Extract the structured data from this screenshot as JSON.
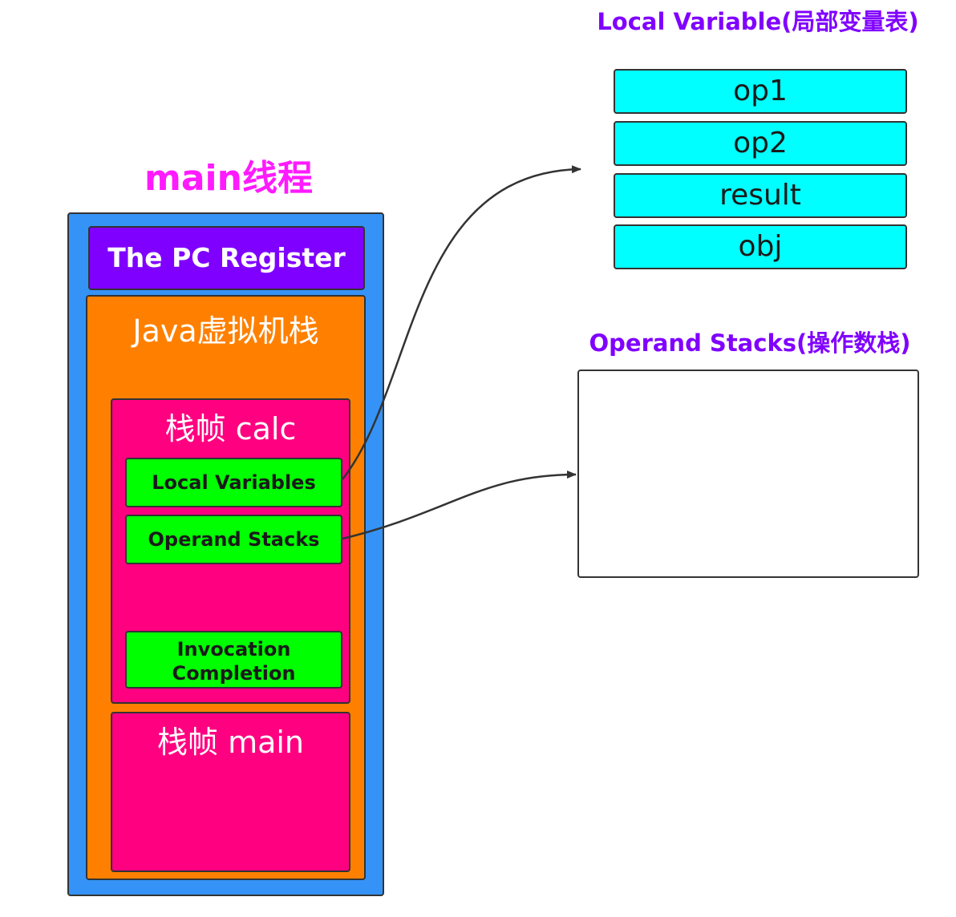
{
  "thread_title": "main线程",
  "pc_register": "The PC Register",
  "jvm_stack": "Java虚拟机栈",
  "frame_calc": {
    "label": "栈帧  calc",
    "local_variables": "Local Variables",
    "operand_stacks": "Operand Stacks",
    "invocation_line1": "Invocation",
    "invocation_line2": "Completion"
  },
  "frame_main": {
    "label": "栈帧  main"
  },
  "local_variable_table": {
    "title": "Local Variable(局部变量表)",
    "cells": [
      "op1",
      "op2",
      "result",
      "obj"
    ]
  },
  "operand_stacks_panel": {
    "title": "Operand Stacks(操作数栈)"
  },
  "colors": {
    "thread": "#3593f7",
    "pc_register": "#7f00ff",
    "jvm_stack": "#ff8000",
    "frame": "#ff0080",
    "slot": "#00ff00",
    "lv_cell": "#00ffff",
    "title_purple": "#8000ff",
    "thread_title": "#ff1aff"
  }
}
